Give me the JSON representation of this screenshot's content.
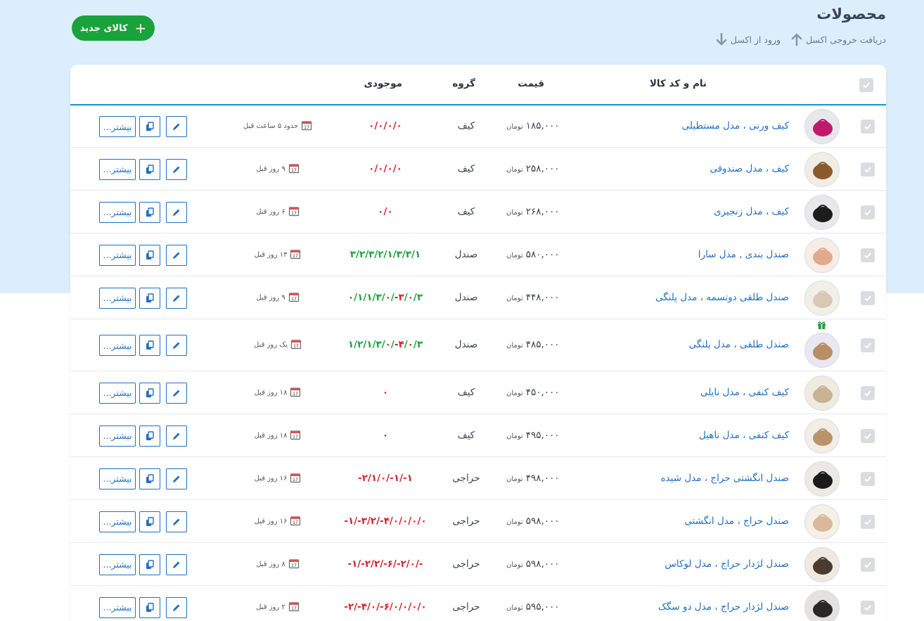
{
  "page": {
    "title": "محصولات",
    "import_label": "ورود از اکسل",
    "export_label": "دریافت خروجی اکسل",
    "new_button_label": "کالای جدید"
  },
  "table": {
    "headers": {
      "name": "نام و کد کالا",
      "price": "قیمت",
      "group": "گروه",
      "stock": "موجودی"
    },
    "more_label": "بیشتر...",
    "currency": "تومان",
    "colors": {
      "green": "#1aa33c",
      "red": "#d0222a",
      "link": "#1f6fc2"
    },
    "rows": [
      {
        "name": "کیف ورنی ، مدل مستطیلی",
        "price": "۱۸۵,۰۰۰",
        "group": "کیف",
        "stock": "۰/۰/۰/۰",
        "stock_color": "red",
        "time": "حدود ۵ ساعت قبل",
        "thumb": "pink-bag",
        "gift": false
      },
      {
        "name": "کیف ، مدل صندوقی",
        "price": "۲۵۸,۰۰۰",
        "group": "کیف",
        "stock": "۰/۰/۰/۰",
        "stock_color": "red",
        "time": "۹ روز قبل",
        "thumb": "brown-bag",
        "gift": false
      },
      {
        "name": "کیف ، مدل زنجیری",
        "price": "۲۶۸,۰۰۰",
        "group": "کیف",
        "stock": "۰/۰",
        "stock_color": "red",
        "time": "۶ روز قبل",
        "thumb": "black-bag",
        "gift": false
      },
      {
        "name": "صندل بندی , مدل سارا",
        "price": "۵۸۰,۰۰۰",
        "group": "صندل",
        "stock": "۳/۲/۳/۲/۱/۳/۳/۱",
        "stock_color": "green",
        "time": "۱۳ روز قبل",
        "thumb": "sandal-pink",
        "gift": false
      },
      {
        "name": "صندل طلقی دوتسمه ، مدل پلنگی",
        "price": "۴۴۸,۰۰۰",
        "group": "صندل",
        "stock": "۰/۱/۱/۳/۰/-۳/۰/۳",
        "stock_color": "mixed",
        "time": "۹ روز قبل",
        "thumb": "sandal-white",
        "gift": false
      },
      {
        "name": "صندل طلقی ، مدل پلنگی",
        "price": "۴۸۵,۰۰۰",
        "group": "صندل",
        "stock": "۱/۲/۱/۳/۰/-۴/۰/۳",
        "stock_color": "mixed",
        "time": "یک روز قبل",
        "thumb": "sandal-leopard",
        "gift": true
      },
      {
        "name": "کیف کنفی ، مدل نایلی",
        "price": "۴۵۰,۰۰۰",
        "group": "کیف",
        "stock": "۰",
        "stock_color": "red",
        "time": "۱۸ روز قبل",
        "thumb": "beige-bag",
        "gift": false
      },
      {
        "name": "کیف کنفی ، مدل ناهیل",
        "price": "۴۹۵,۰۰۰",
        "group": "کیف",
        "stock": "۰",
        "stock_color": "red",
        "time": "۱۸ روز قبل",
        "thumb": "tan-bag",
        "gift": false
      },
      {
        "name": "صندل انگشتی حراج ، مدل شیده",
        "price": "۴۹۸,۰۰۰",
        "group": "حراجی",
        "stock": "-۲/۱/۰/-۱/-۱",
        "stock_color": "red",
        "time": "۱۶ روز قبل",
        "thumb": "sandal-black",
        "gift": false
      },
      {
        "name": "صندل حراج ، مدل انگشتی",
        "price": "۵۹۸,۰۰۰",
        "group": "حراجی",
        "stock": "-۱/-۳/۲/-۴/۰/۰/۰/۰",
        "stock_color": "red",
        "time": "۱۶ روز قبل",
        "thumb": "sandal-cream",
        "gift": false
      },
      {
        "name": "صندل لژدار حراج ، مدل لوکاس",
        "price": "۵۹۸,۰۰۰",
        "group": "حراجی",
        "stock": "-۱/-۲/۲/-۶/-۲/۰/-",
        "stock_color": "red",
        "time": "۸ روز قبل",
        "thumb": "sandal-legs",
        "gift": false
      },
      {
        "name": "صندل لژدار حراج ، مدل دو سگک",
        "price": "۵۹۵,۰۰۰",
        "group": "حراجی",
        "stock": "-۲/-۴/۰/-۶/۰/۰/۰/۰",
        "stock_color": "red",
        "time": "۲ روز قبل",
        "thumb": "sandal-dark",
        "gift": false
      }
    ]
  }
}
